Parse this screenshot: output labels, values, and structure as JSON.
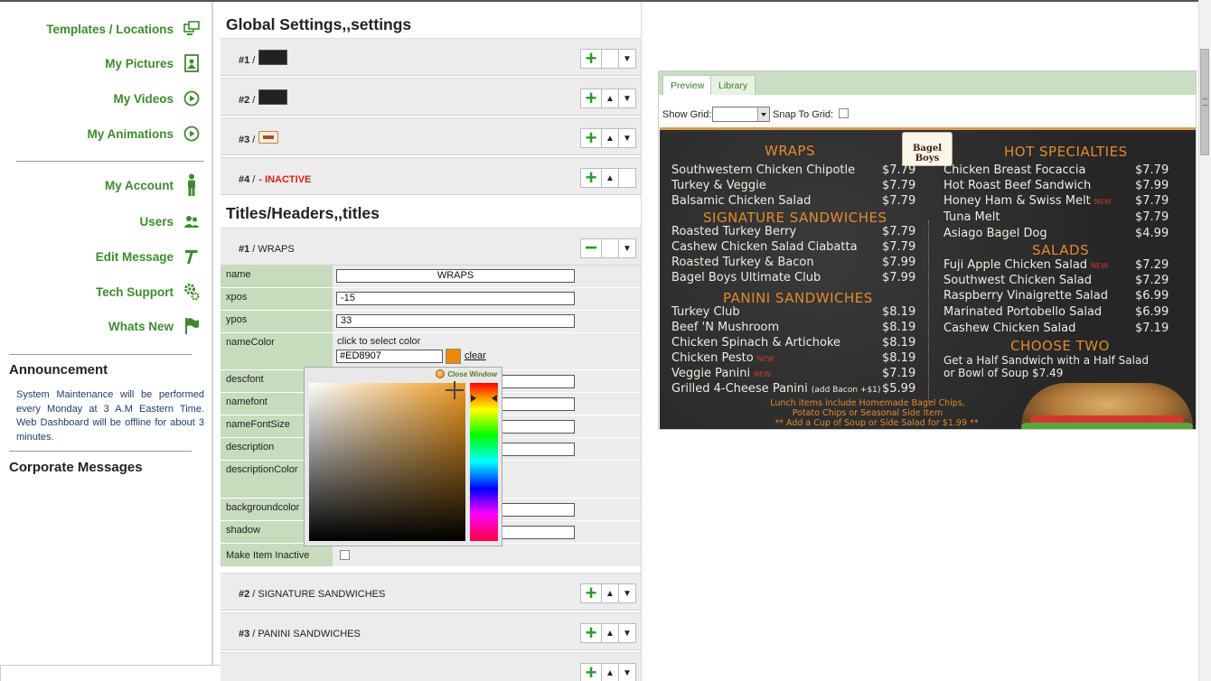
{
  "sidebar": {
    "nav": [
      {
        "label": "Templates / Locations",
        "icon": "screens-icon"
      },
      {
        "label": "My Pictures",
        "icon": "picture-icon"
      },
      {
        "label": "My Videos",
        "icon": "play-icon"
      },
      {
        "label": "My Animations",
        "icon": "play-icon"
      },
      {
        "label": "My Account",
        "icon": "person-icon"
      },
      {
        "label": "Users",
        "icon": "users-icon"
      },
      {
        "label": "Edit Message",
        "icon": "text-icon"
      },
      {
        "label": "Tech Support",
        "icon": "gears-icon"
      },
      {
        "label": "Whats New",
        "icon": "flag-icon"
      }
    ],
    "announcement_title": "Announcement",
    "announcement_text": "System Maintenance will be performed every Monday at 3 A.M Eastern Time. Web Dashboard will be offline for about 3 minutes.",
    "corporate_title": "Corporate Messages"
  },
  "global": {
    "title": "Global Settings,,settings",
    "rows": [
      {
        "num": "#1",
        "sep": " /"
      },
      {
        "num": "#2",
        "sep": " /"
      },
      {
        "num": "#3",
        "sep": " /"
      },
      {
        "num": "#4",
        "sep": " /",
        "status": "- INACTIVE"
      }
    ]
  },
  "titles": {
    "title": "Titles/Headers,,titles",
    "expanded": {
      "num": "#1",
      "name": "/ WRAPS"
    },
    "props": {
      "name": {
        "label": "name",
        "value": "WRAPS"
      },
      "xpos": {
        "label": "xpos",
        "value": "-15"
      },
      "ypos": {
        "label": "ypos",
        "value": "33"
      },
      "nameColor": {
        "label": "nameColor",
        "hint": "click to select color",
        "value": "#ED8907",
        "clear": "clear"
      },
      "descfont": {
        "label": "descfont"
      },
      "namefont": {
        "label": "namefont"
      },
      "nameFontSize": {
        "label": "nameFontSize"
      },
      "description": {
        "label": "description"
      },
      "descriptionColor": {
        "label": "descriptionColor"
      },
      "backgroundcolor": {
        "label": "backgroundcolor"
      },
      "shadow": {
        "label": "shadow"
      },
      "inactive": {
        "label": "Make Item Inactive"
      }
    },
    "rows": [
      {
        "num": "#2",
        "name": "/ SIGNATURE SANDWICHES"
      },
      {
        "num": "#3",
        "name": "/ PANINI SANDWICHES"
      }
    ]
  },
  "picker": {
    "close_label": "Close Window",
    "color": "#ED8907"
  },
  "preview": {
    "tabs": [
      "Preview",
      "Library"
    ],
    "show_grid_label": "Show Grid:",
    "snap_label": "Snap To Grid:",
    "logo_text": "Bagel Boys",
    "wraps": {
      "heading": "WRAPS",
      "items": [
        {
          "name": "Southwestern Chicken Chipotle",
          "price": "$7.79"
        },
        {
          "name": "Turkey & Veggie",
          "price": "$7.79"
        },
        {
          "name": "Balsamic Chicken Salad",
          "price": "$7.79"
        }
      ]
    },
    "signature": {
      "heading": "SIGNATURE SANDWICHES",
      "items": [
        {
          "name": "Roasted Turkey Berry",
          "price": "$7.79"
        },
        {
          "name": "Cashew Chicken Salad Ciabatta",
          "price": "$7.79"
        },
        {
          "name": "Roasted Turkey & Bacon",
          "price": "$7.99"
        },
        {
          "name": "Bagel Boys Ultimate Club",
          "price": "$7.99"
        }
      ]
    },
    "panini": {
      "heading": "PANINI SANDWICHES",
      "items": [
        {
          "name": "Turkey Club",
          "price": "$8.19"
        },
        {
          "name": "Beef 'N Mushroom",
          "price": "$8.19"
        },
        {
          "name": "Chicken Spinach & Artichoke",
          "price": "$8.19"
        },
        {
          "name": "Chicken Pesto",
          "price": "$8.19",
          "badge": "NEW"
        },
        {
          "name": "Veggie Panini",
          "price": "$7.19",
          "badge": "NEW"
        },
        {
          "name": "Grilled 4-Cheese Panini",
          "extra": "(add Bacon +$1)",
          "price": "$5.99"
        }
      ]
    },
    "lunch_note": "Lunch items include Homemade Bagel Chips, Potato Chips or Seasonal Side Item",
    "add_note": "** Add a Cup of Soup or Side Salad for $1.99 **",
    "hot": {
      "heading": "HOT SPECIALTIES",
      "items": [
        {
          "name": "Chicken Breast Focaccia",
          "price": "$7.79"
        },
        {
          "name": "Hot Roast Beef Sandwich",
          "price": "$7.99"
        },
        {
          "name": "Honey Ham & Swiss Melt",
          "price": "$7.79",
          "badge": "NEW"
        },
        {
          "name": "Tuna Melt",
          "price": "$7.79"
        },
        {
          "name": "Asiago Bagel Dog",
          "price": "$4.99"
        }
      ]
    },
    "salads": {
      "heading": "SALADS",
      "items": [
        {
          "name": "Fuji Apple Chicken Salad",
          "price": "$7.29",
          "badge": "NEW"
        },
        {
          "name": "Southwest Chicken Salad",
          "price": "$7.29"
        },
        {
          "name": "Raspberry Vinaigrette Salad",
          "price": "$6.99"
        },
        {
          "name": "Marinated Portobello Salad",
          "price": "$6.99"
        },
        {
          "name": "Cashew Chicken Salad",
          "price": "$7.19"
        }
      ]
    },
    "choose": {
      "heading": "CHOOSE TWO",
      "text": "Get a Half Sandwich with a Half Salad or Bowl of Soup $7.49"
    }
  }
}
